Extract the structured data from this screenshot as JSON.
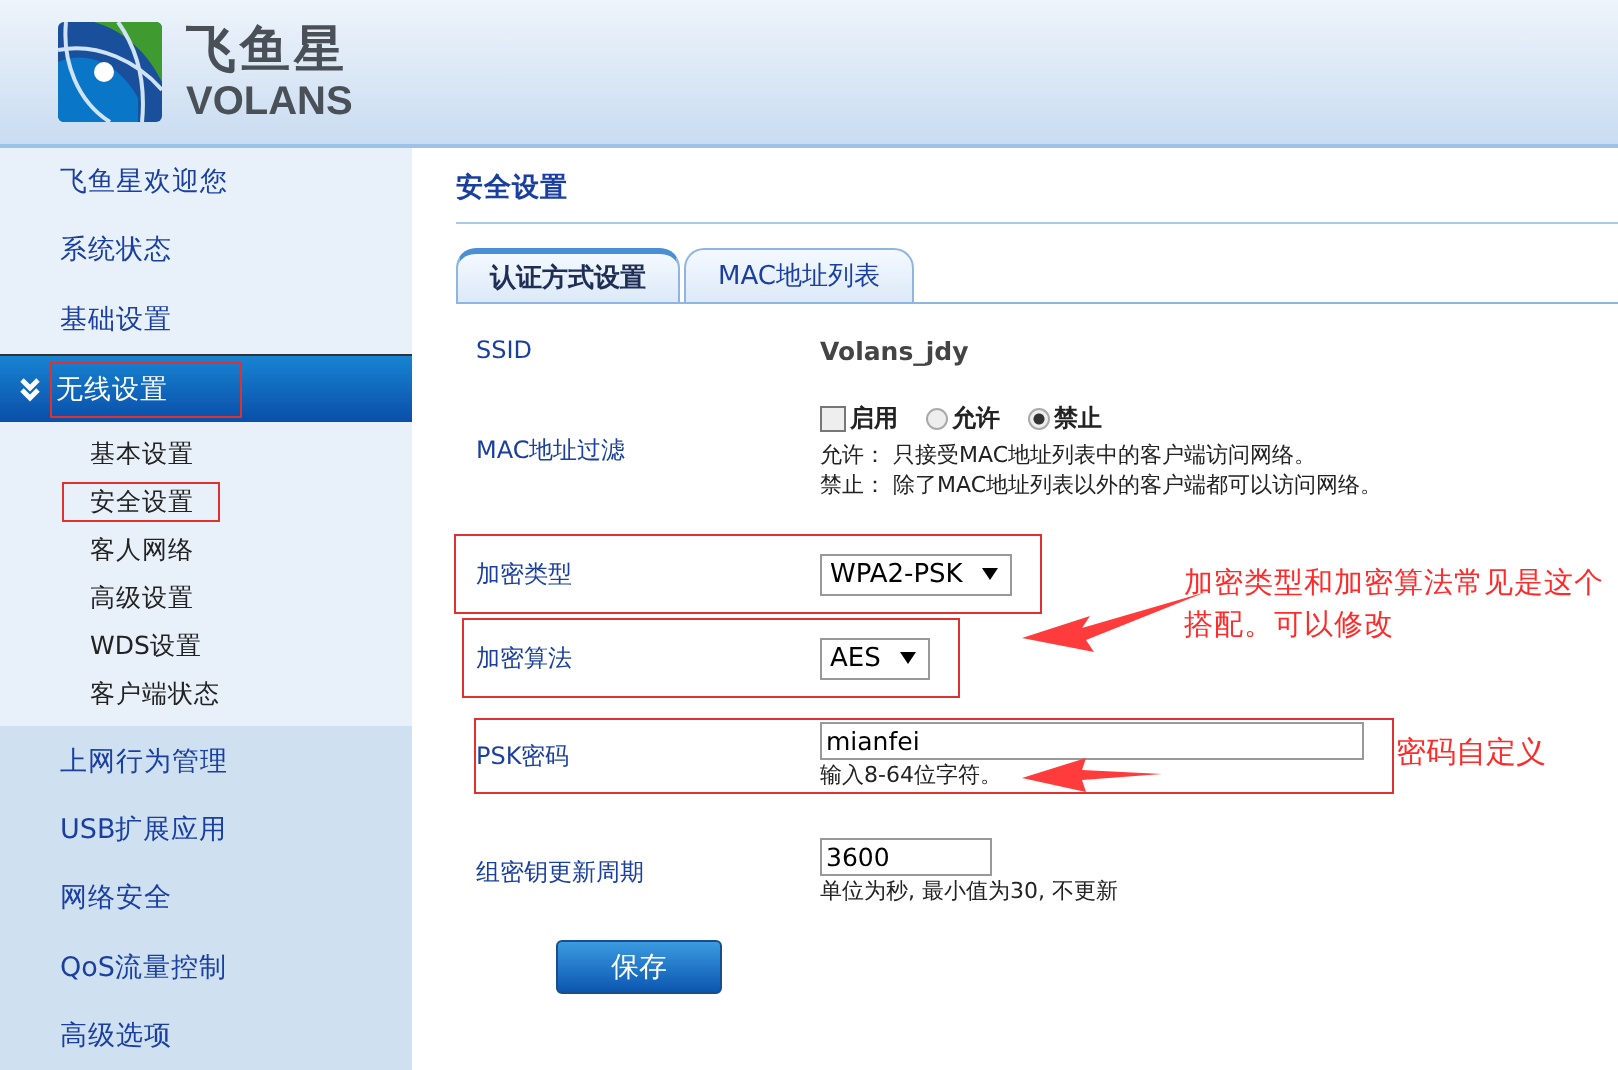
{
  "header": {
    "logo": {
      "name_cn": "飞鱼星",
      "name_en": "VOLANS"
    }
  },
  "sidebar": {
    "items": [
      {
        "label": "飞鱼星欢迎您",
        "selected": false,
        "annotated": false
      },
      {
        "label": "系统状态",
        "selected": false,
        "annotated": false
      },
      {
        "label": "基础设置",
        "selected": false,
        "annotated": false
      },
      {
        "label": "无线设置",
        "selected": true,
        "annotated": true,
        "children": [
          {
            "label": "基本设置",
            "annotated": false
          },
          {
            "label": "安全设置",
            "annotated": true
          },
          {
            "label": "客人网络",
            "annotated": false
          },
          {
            "label": "高级设置",
            "annotated": false
          },
          {
            "label": "WDS设置",
            "annotated": false
          },
          {
            "label": "客户端状态",
            "annotated": false
          }
        ]
      },
      {
        "label": "上网行为管理",
        "selected": false,
        "annotated": false
      },
      {
        "label": "USB扩展应用",
        "selected": false,
        "annotated": false
      },
      {
        "label": "网络安全",
        "selected": false,
        "annotated": false
      },
      {
        "label": "QoS流量控制",
        "selected": false,
        "annotated": false
      },
      {
        "label": "高级选项",
        "selected": false,
        "annotated": false
      }
    ]
  },
  "main": {
    "title": "安全设置",
    "tabs": [
      {
        "label": "认证方式设置",
        "selected": true
      },
      {
        "label": "MAC地址列表",
        "selected": false
      }
    ],
    "rows": [
      {
        "kind": "text",
        "label": "SSID",
        "value": "Volans_jdy",
        "annotated": false
      },
      {
        "kind": "mac_filter",
        "label": "MAC地址过滤",
        "annotated": false,
        "checkbox": {
          "label": "启用",
          "checked": false
        },
        "radios": [
          {
            "label": "允许",
            "selected": false
          },
          {
            "label": "禁止",
            "selected": true
          }
        ],
        "notes": [
          "允许： 只接受MAC地址列表中的客户端访问网络。",
          "禁止： 除了MAC地址列表以外的客户端都可以访问网络。"
        ]
      },
      {
        "kind": "select",
        "label": "加密类型",
        "value": "WPA2-PSK",
        "annotated": true
      },
      {
        "kind": "select",
        "label": "加密算法",
        "value": "AES",
        "annotated": true
      },
      {
        "kind": "input",
        "label": "PSK密码",
        "value": "mianfei",
        "hint": "输入8-64位字符。",
        "wide": true,
        "annotated": true
      },
      {
        "kind": "input",
        "label": "组密钥更新周期",
        "value": "3600",
        "hint": "单位为秒, 最小值为30, 不更新",
        "wide": false,
        "annotated": false
      }
    ],
    "save_button": "保存",
    "annotations": [
      "加密类型和加密算法常见是这个搭配。可以修改",
      "密码自定义"
    ]
  }
}
